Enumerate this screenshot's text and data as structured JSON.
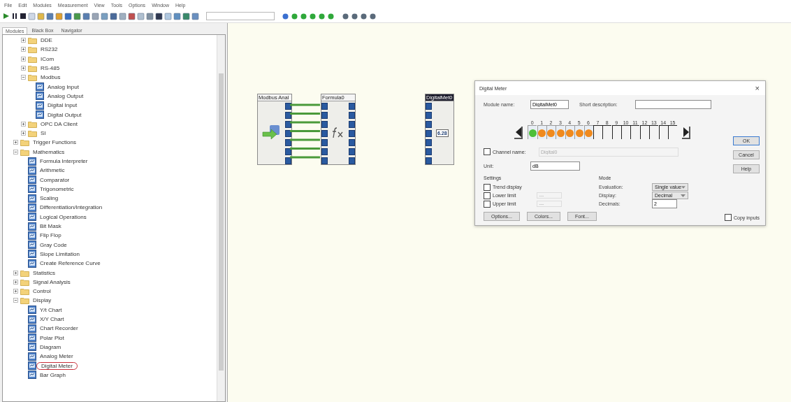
{
  "menu": [
    "File",
    "Edit",
    "Modules",
    "Measurement",
    "View",
    "Tools",
    "Options",
    "Window",
    "Help"
  ],
  "panel_tabs": [
    {
      "label": "Modules",
      "selected": true
    },
    {
      "label": "Black Box",
      "selected": false
    },
    {
      "label": "Navigator",
      "selected": false
    }
  ],
  "tree": {
    "continued": [
      {
        "label": "DDE",
        "kind": "folder",
        "expanded": false
      },
      {
        "label": "RS232",
        "kind": "folder",
        "expanded": false
      },
      {
        "label": "ICom",
        "kind": "folder",
        "expanded": false
      },
      {
        "label": "RS-485",
        "kind": "folder",
        "expanded": false
      },
      {
        "label": "Modbus",
        "kind": "folder",
        "expanded": true,
        "children": [
          {
            "label": "Analog Input",
            "kind": "module"
          },
          {
            "label": "Analog Output",
            "kind": "module"
          },
          {
            "label": "Digital Input",
            "kind": "module"
          },
          {
            "label": "Digital Output",
            "kind": "module"
          }
        ]
      },
      {
        "label": "OPC DA Client",
        "kind": "folder",
        "expanded": false
      },
      {
        "label": "SI",
        "kind": "folder",
        "expanded": false
      }
    ],
    "items": [
      {
        "label": "Trigger Functions",
        "kind": "folder",
        "expanded": false
      },
      {
        "label": "Mathematics",
        "kind": "folder",
        "expanded": true,
        "children": [
          {
            "label": "Formula Interpreter",
            "kind": "module"
          },
          {
            "label": "Arithmetic",
            "kind": "module"
          },
          {
            "label": "Comparator",
            "kind": "module"
          },
          {
            "label": "Trigonometric",
            "kind": "module"
          },
          {
            "label": "Scaling",
            "kind": "module"
          },
          {
            "label": "Differentiation/Integration",
            "kind": "module"
          },
          {
            "label": "Logical Operations",
            "kind": "module"
          },
          {
            "label": "Bit Mask",
            "kind": "module"
          },
          {
            "label": "Flip Flop",
            "kind": "module"
          },
          {
            "label": "Gray Code",
            "kind": "module"
          },
          {
            "label": "Slope Limitation",
            "kind": "module"
          },
          {
            "label": "Create Reference Curve",
            "kind": "module"
          }
        ]
      },
      {
        "label": "Statistics",
        "kind": "folder",
        "expanded": false
      },
      {
        "label": "Signal Analysis",
        "kind": "folder",
        "expanded": false
      },
      {
        "label": "Control",
        "kind": "folder",
        "expanded": false
      },
      {
        "label": "Display",
        "kind": "folder",
        "expanded": true,
        "children": [
          {
            "label": "Y/t Chart",
            "kind": "module"
          },
          {
            "label": "X/Y Chart",
            "kind": "module"
          },
          {
            "label": "Chart Recorder",
            "kind": "module"
          },
          {
            "label": "Polar Plot",
            "kind": "module"
          },
          {
            "label": "Diagram",
            "kind": "module"
          },
          {
            "label": "Analog Meter",
            "kind": "module"
          },
          {
            "label": "Digital Meter",
            "kind": "module",
            "highlighted": true
          },
          {
            "label": "Bar Graph",
            "kind": "module"
          }
        ]
      }
    ]
  },
  "canvas": {
    "blocks": [
      {
        "title": "Modbus Anal",
        "kind": "source"
      },
      {
        "title": "Formula0",
        "kind": "formula"
      },
      {
        "title": "DigitalMet0",
        "kind": "meter",
        "reading": "6.28"
      }
    ]
  },
  "dialog": {
    "title": "Digital Meter",
    "close": "×",
    "module_name": {
      "label": "Module name:",
      "value": "DigitalMet0"
    },
    "short_description": {
      "label": "Short description:"
    },
    "channels": [
      {
        "number": "0",
        "active": true,
        "color": "#4cbf3a"
      },
      {
        "number": "1",
        "active": true,
        "color": "#f08a1e"
      },
      {
        "number": "2",
        "active": true,
        "color": "#f08a1e"
      },
      {
        "number": "3",
        "active": true,
        "color": "#f08a1e"
      },
      {
        "number": "4",
        "active": true,
        "color": "#f08a1e"
      },
      {
        "number": "5",
        "active": true,
        "color": "#f08a1e"
      },
      {
        "number": "6",
        "active": true,
        "color": "#f08a1e"
      },
      {
        "number": "7",
        "active": false
      },
      {
        "number": "8",
        "active": false
      },
      {
        "number": "9",
        "active": false
      },
      {
        "number": "10",
        "active": false
      },
      {
        "number": "11",
        "active": false
      },
      {
        "number": "12",
        "active": false
      },
      {
        "number": "13",
        "active": false
      },
      {
        "number": "14",
        "active": false
      },
      {
        "number": "15",
        "active": false
      }
    ],
    "channel_name": {
      "label": "Channel name:",
      "checked": false,
      "value": "Digital0"
    },
    "unit": {
      "label": "Unit:",
      "value": "dB"
    },
    "buttons": [
      "OK",
      "Cancel",
      "Help"
    ],
    "settings": {
      "title": "Settings",
      "options": [
        {
          "label": "Trend display",
          "checked": false
        },
        {
          "label": "Lower limit",
          "checked": false,
          "value": "---"
        },
        {
          "label": "Upper limit",
          "checked": false,
          "value": "---"
        }
      ]
    },
    "mode": {
      "title": "Mode",
      "evaluation": {
        "label": "Evaluation:",
        "value": "Single value"
      },
      "display": {
        "label": "Display:",
        "value": "Decimal"
      },
      "decimals": {
        "label": "Decimals:",
        "value": "2"
      }
    },
    "footer_buttons": [
      "Options...",
      "Colors...",
      "Font..."
    ],
    "copy_inputs": {
      "label": "Copy inputs",
      "checked": false
    }
  }
}
